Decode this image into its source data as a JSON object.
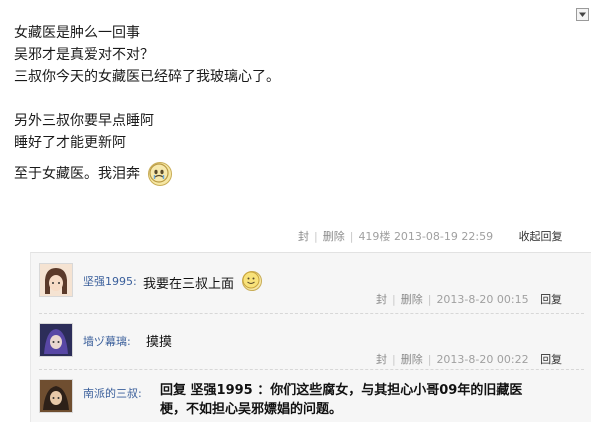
{
  "post": {
    "lines": [
      "女藏医是肿么一回事",
      "吴邪才是真爱对不对？",
      "三叔你今天的女藏医已经碎了我玻璃心了。",
      "",
      "另外三叔你要早点睡阿",
      "睡好了才能更新阿",
      "至于女藏医。我泪奔"
    ],
    "meta": {
      "report": "封",
      "delete": "删除",
      "floor": "419楼",
      "timestamp": "2013-08-19 22:59",
      "collapse": "收起回复"
    }
  },
  "replies": [
    {
      "user": "坚强1995:",
      "text": "我要在三叔上面",
      "report": "封",
      "delete": "删除",
      "timestamp": "2013-8-20 00:15",
      "reply": "回复"
    },
    {
      "user": "墙ヅ幕璃:",
      "text": "摸摸",
      "report": "封",
      "delete": "删除",
      "timestamp": "2013-8-20 00:22",
      "reply": "回复"
    },
    {
      "user": "南派的三叔:",
      "text_line1": "回复 坚强1995 ：你们这些腐女，与其担心小哥09年的旧藏医",
      "text_line2": "梗，不如担心吴邪嫖娼的问题。"
    }
  ],
  "colors": {
    "username": "#3a5f9b",
    "reply_bg": "#f6f6f6"
  },
  "icons": [
    "dropdown-arrow-icon",
    "smiley-emoji-icon",
    "crying-emoji-icon"
  ]
}
